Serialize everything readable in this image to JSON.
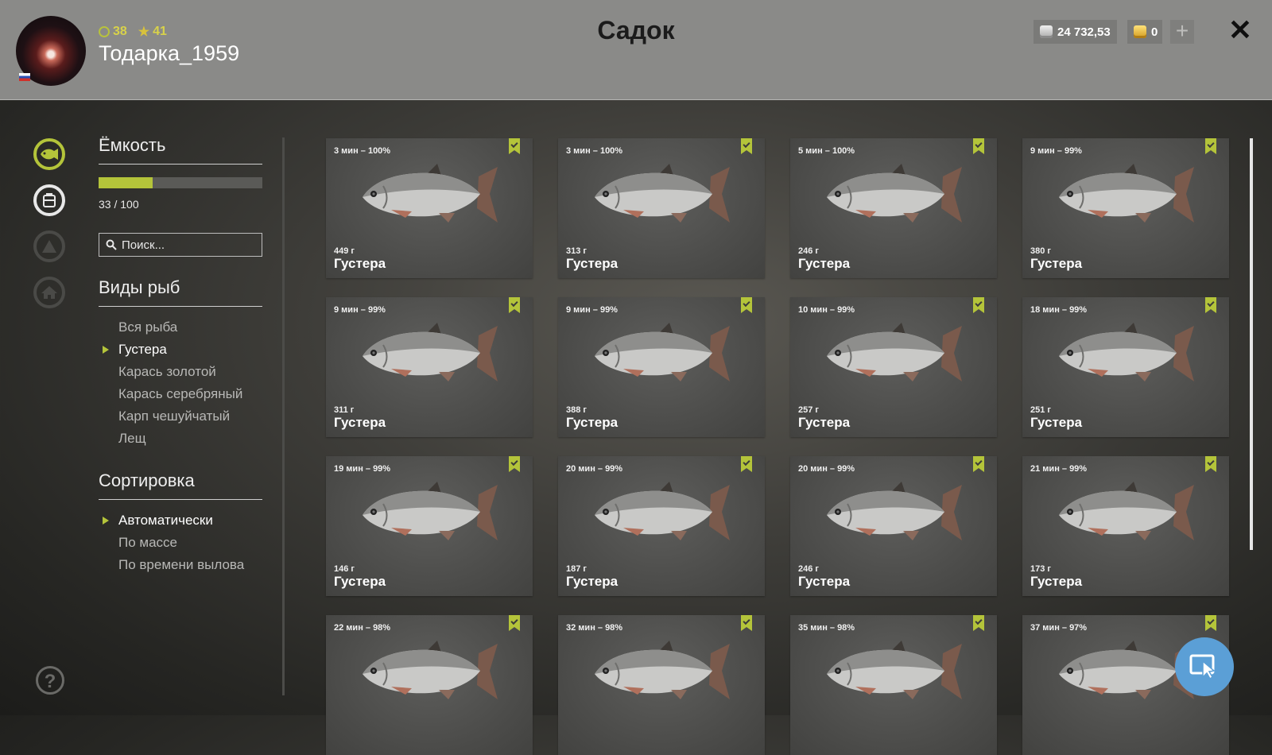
{
  "header": {
    "title": "Садок",
    "username": "Тодарка_1959",
    "level": "38",
    "rating": "41",
    "silver": "24 732,53",
    "gold": "0",
    "plus_label": "+",
    "close_label": "✕"
  },
  "capacity": {
    "title": "Ёмкость",
    "current": 33,
    "max": 100,
    "text": "33 / 100"
  },
  "search": {
    "placeholder": "Поиск..."
  },
  "species": {
    "title": "Виды рыб",
    "items": [
      {
        "label": "Вся рыба",
        "active": false
      },
      {
        "label": "Густера",
        "active": true
      },
      {
        "label": "Карась золотой",
        "active": false
      },
      {
        "label": "Карась серебряный",
        "active": false
      },
      {
        "label": "Карп чешуйчатый",
        "active": false
      },
      {
        "label": "Лещ",
        "active": false
      }
    ]
  },
  "sorting": {
    "title": "Сортировка",
    "items": [
      {
        "label": "Автоматически",
        "active": true
      },
      {
        "label": "По массе",
        "active": false
      },
      {
        "label": "По времени вылова",
        "active": false
      }
    ]
  },
  "fish": [
    {
      "time": "3 мин – 100%",
      "weight": "449 г",
      "name": "Густера"
    },
    {
      "time": "3 мин – 100%",
      "weight": "313 г",
      "name": "Густера"
    },
    {
      "time": "5 мин – 100%",
      "weight": "246 г",
      "name": "Густера"
    },
    {
      "time": "9 мин – 99%",
      "weight": "380 г",
      "name": "Густера"
    },
    {
      "time": "9 мин – 99%",
      "weight": "311 г",
      "name": "Густера"
    },
    {
      "time": "9 мин – 99%",
      "weight": "388 г",
      "name": "Густера"
    },
    {
      "time": "10 мин – 99%",
      "weight": "257 г",
      "name": "Густера"
    },
    {
      "time": "18 мин – 99%",
      "weight": "251 г",
      "name": "Густера"
    },
    {
      "time": "19 мин – 99%",
      "weight": "146 г",
      "name": "Густера"
    },
    {
      "time": "20 мин – 99%",
      "weight": "187 г",
      "name": "Густера"
    },
    {
      "time": "20 мин – 99%",
      "weight": "246 г",
      "name": "Густера"
    },
    {
      "time": "21 мин – 99%",
      "weight": "173 г",
      "name": "Густера"
    },
    {
      "time": "22 мин – 98%",
      "weight": "",
      "name": ""
    },
    {
      "time": "32 мин – 98%",
      "weight": "",
      "name": ""
    },
    {
      "time": "35 мин – 98%",
      "weight": "",
      "name": ""
    },
    {
      "time": "37 мин – 97%",
      "weight": "",
      "name": ""
    }
  ],
  "help": {
    "label": "?"
  },
  "colors": {
    "accent": "#b4c43a",
    "fab": "#5b9fd6"
  }
}
